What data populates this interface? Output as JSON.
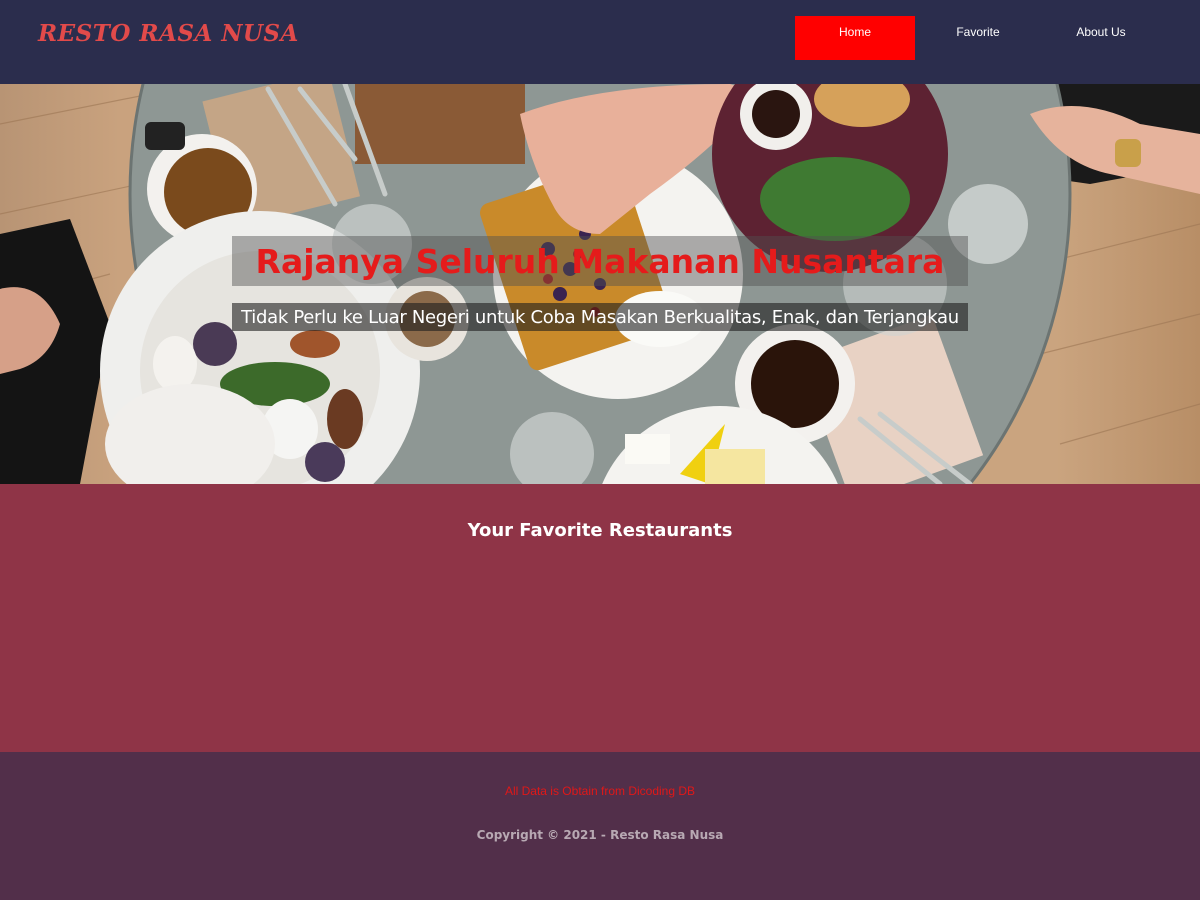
{
  "header": {
    "brand": "RESTO RASA NUSA",
    "nav": [
      {
        "label": "Home",
        "active": true
      },
      {
        "label": "Favorite",
        "active": false
      },
      {
        "label": "About Us",
        "active": false
      }
    ]
  },
  "hero": {
    "title": "Rajanya Seluruh Makanan Nusantara",
    "subtitle": "Tidak Perlu ke Luar Negeri untuk Coba Masakan Berkualitas, Enak, dan Terjangkau",
    "image": "dining-table-food-photo"
  },
  "main": {
    "section_title": "Your Favorite Restaurants"
  },
  "footer": {
    "source": "All Data is Obtain from Dicoding DB",
    "copyright": "Copyright © 2021 - Resto Rasa Nusa"
  },
  "colors": {
    "header_bg": "#2b2d4d",
    "nav_active": "#ff0000",
    "brand": "#e24a4a",
    "main_bg": "#8f3447",
    "footer_bg": "#522f4a",
    "hero_title": "#e51b1b"
  }
}
